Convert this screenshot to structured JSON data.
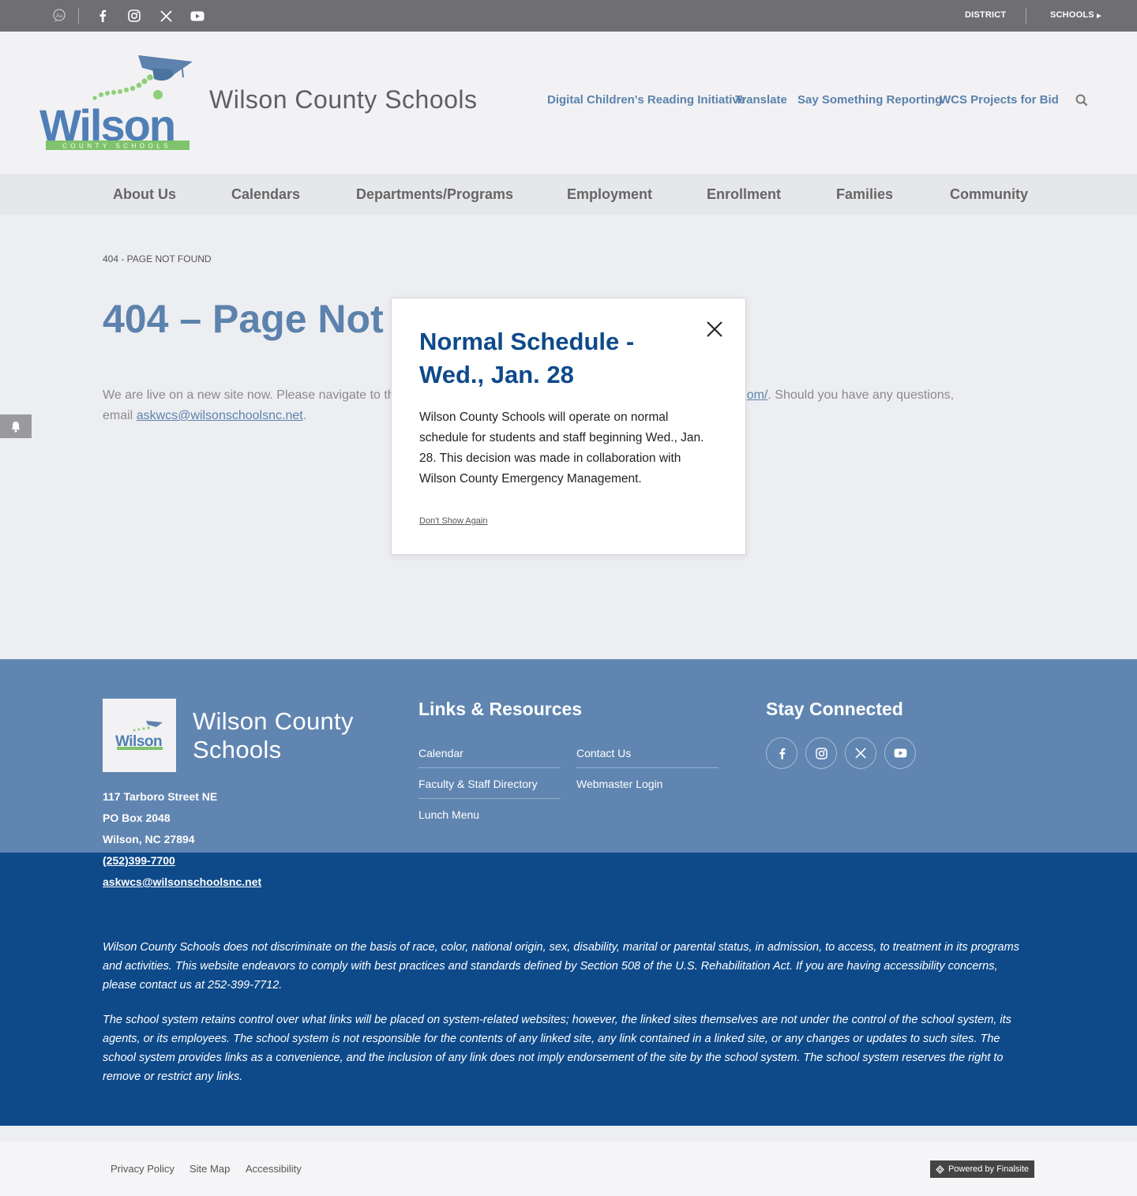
{
  "topbar": {
    "district_label": "DISTRICT",
    "schools_label": "SCHOOLS"
  },
  "header": {
    "site_title": "Wilson County Schools",
    "logo_word": "Wilson",
    "logo_sub": "COUNTY SCHOOLS",
    "quick_links": [
      "Digital Children's Reading Initiative",
      "Translate",
      "Say Something Reporting",
      "WCS Projects for Bid"
    ]
  },
  "nav": {
    "items": [
      "About Us",
      "Calendars",
      "Departments/Programs",
      "Employment",
      "Enrollment",
      "Families",
      "Community"
    ]
  },
  "page": {
    "breadcrumb": "404 - PAGE NOT FOUND",
    "heading": "404 – Page Not",
    "text_before": "We are live on a new site now. Please navigate to th",
    "link_partial": "om/",
    "text_after": ". Should you have any questions,",
    "email_prefix": "email ",
    "email": "askwcs@wilsonschoolsnc.net",
    "email_suffix": "."
  },
  "modal": {
    "title": "Normal Schedule - Wed., Jan. 28",
    "body": "Wilson County Schools will operate on normal schedule for students and staff beginning Wed., Jan. 28. This decision was made in collaboration with Wilson County Emergency Management.",
    "dismiss": "Don't Show Again"
  },
  "footer": {
    "name": "Wilson County Schools",
    "logo_word": "Wilson",
    "address": [
      "117 Tarboro Street NE",
      "PO Box 2048",
      "Wilson, NC  27894"
    ],
    "phone": "(252)399-7700",
    "email": "askwcs@wilsonschoolsnc.net",
    "links_heading": "Links & Resources",
    "links_col1": [
      "Calendar",
      "Faculty & Staff Directory",
      "Lunch Menu"
    ],
    "links_col2": [
      "Contact Us",
      "Webmaster Login"
    ],
    "social_heading": "Stay Connected",
    "disclaimer_1": "Wilson County Schools does not discriminate on the basis of race, color, national origin, sex, disability, marital or parental status, in admission, to access, to treatment in its programs and activities. This website endeavors to comply with best practices and standards defined by Section 508 of the U.S. Rehabilitation Act. If you are having accessibility concerns, please contact us at 252-399-7712.",
    "disclaimer_2": "The school system retains control over what links will be placed on system-related websites; however, the linked sites themselves are not under the control of the school system, its agents, or its employees. The school system is not responsible for the contents of any linked site, any link contained in a linked site, or any changes or updates to such sites. The school system provides links as a convenience, and the inclusion of any link does not imply endorsement of the site by the school system. The school system reserves the right to remove or restrict any links."
  },
  "bottom": {
    "links": [
      "Privacy Policy",
      "Site Map",
      "Accessibility"
    ],
    "powered": "Powered by Finalsite"
  },
  "colors": {
    "brand_blue": "#0e4a8a",
    "light_blue": "#6085b1",
    "link_blue": "#5b82ad",
    "logo_green": "#7fc36c"
  }
}
